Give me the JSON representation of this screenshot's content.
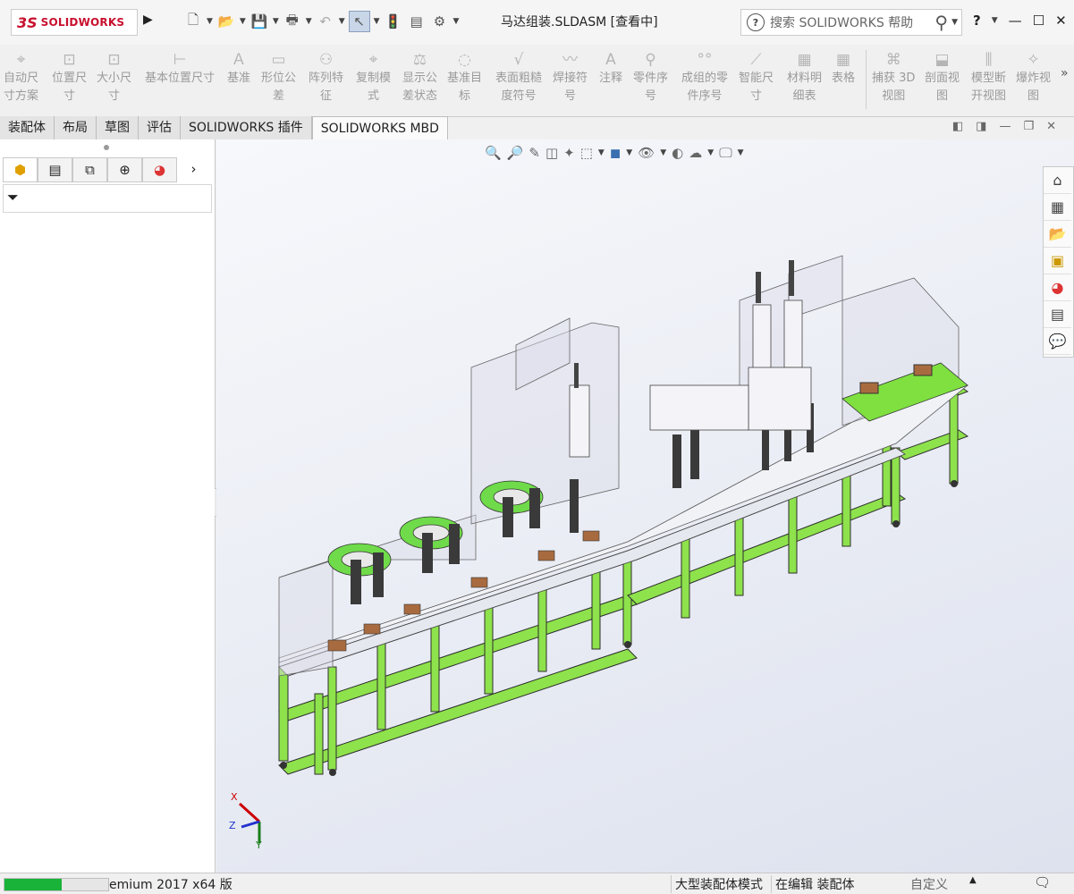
{
  "app": {
    "logo_text": "SOLIDWORKS",
    "document_title": "马达组装.SLDASM [查看中]",
    "search_placeholder": "搜索 SOLIDWORKS 帮助",
    "help_label": "?"
  },
  "quick_access": {
    "icons": [
      "new-file-icon",
      "open-file-icon",
      "save-icon",
      "print-icon",
      "undo-icon",
      "select-icon",
      "rebuild-icon",
      "file-properties-icon",
      "options-icon"
    ]
  },
  "ribbon": {
    "buttons": [
      {
        "label": "自动尺\n寸方案",
        "icon": "auto-dimension-icon"
      },
      {
        "label": "位置尺\n寸",
        "icon": "location-dimension-icon"
      },
      {
        "label": "大小尺\n寸",
        "icon": "size-dimension-icon"
      },
      {
        "label": "基本位置尺寸",
        "icon": "basic-location-dimension-icon"
      },
      {
        "label": "基准",
        "icon": "datum-icon"
      },
      {
        "label": "形位公\n差",
        "icon": "geometric-tolerance-icon"
      },
      {
        "label": "阵列特\n征",
        "icon": "pattern-feature-icon"
      },
      {
        "label": "复制模\n式",
        "icon": "copy-scheme-icon"
      },
      {
        "label": "显示公\n差状态",
        "icon": "show-tolerance-status-icon"
      },
      {
        "label": "基准目\n标",
        "icon": "datum-target-icon"
      },
      {
        "label": "表面粗糙\n度符号",
        "icon": "surface-finish-icon"
      },
      {
        "label": "焊接符\n号",
        "icon": "weld-symbol-icon"
      },
      {
        "label": "注释",
        "icon": "note-icon"
      },
      {
        "label": "零件序\n号",
        "icon": "balloon-icon"
      },
      {
        "label": "成组的零\n件序号",
        "icon": "stacked-balloon-icon"
      },
      {
        "label": "智能尺\n寸",
        "icon": "smart-dimension-icon"
      },
      {
        "label": "材料明\n细表",
        "icon": "bill-of-materials-icon"
      },
      {
        "label": "表格",
        "icon": "table-icon"
      },
      {
        "label": "捕获 3D\n视图",
        "icon": "capture-3d-view-icon"
      },
      {
        "label": "剖面视\n图",
        "icon": "section-view-icon"
      },
      {
        "label": "模型断\n开视图",
        "icon": "model-break-view-icon"
      },
      {
        "label": "爆炸视\n图",
        "icon": "explode-view-icon"
      }
    ]
  },
  "tabs": [
    "装配体",
    "布局",
    "草图",
    "评估",
    "SOLIDWORKS 插件",
    "SOLIDWORKS MBD"
  ],
  "active_tab": "SOLIDWORKS MBD",
  "feature_manager_tabs": [
    "feature-manager-icon",
    "property-manager-icon",
    "configuration-manager-icon",
    "dimxpert-manager-icon",
    "display-manager-icon"
  ],
  "statusbar": {
    "product": "emium 2017 x64 版",
    "mode": "大型装配体模式",
    "editing": "在编辑 装配体",
    "units": "自定义",
    "progress": 0.55
  },
  "triad": {
    "x_label": "X",
    "y_label": "Y",
    "z_label": "Z"
  },
  "colors": {
    "accent_green": "#19b33a",
    "brand_red": "#c8102e",
    "frame_green": "#7fe040"
  }
}
